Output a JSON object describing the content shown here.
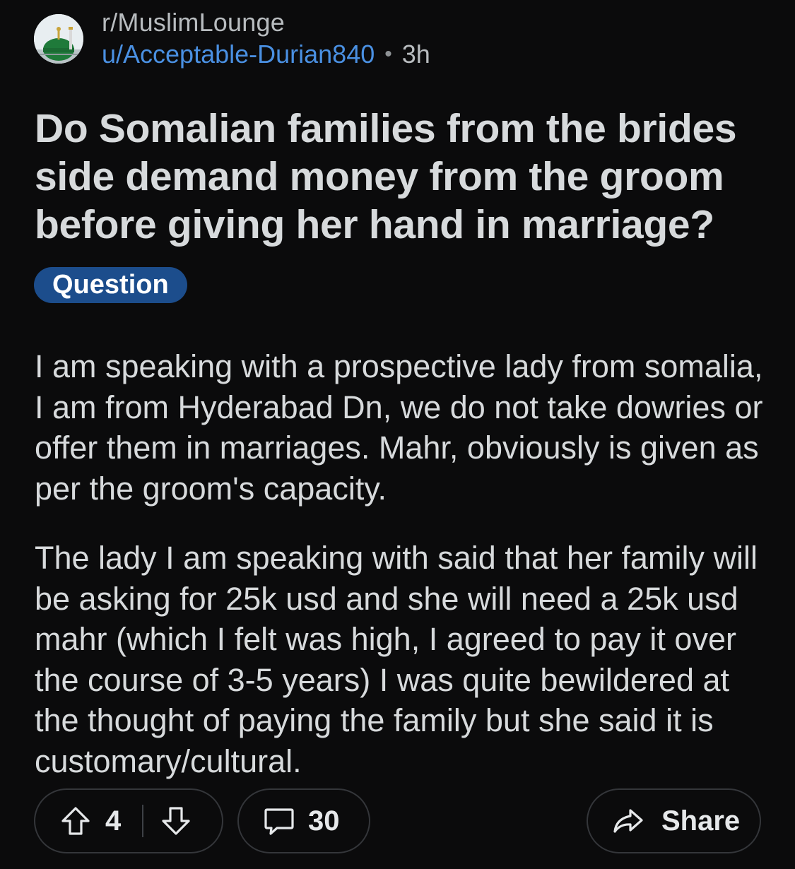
{
  "post": {
    "subreddit": "r/MuslimLounge",
    "author": "u/Acceptable-Durian840",
    "separator": "•",
    "age": "3h",
    "title": "Do Somalian families from the brides side demand money from the groom before giving her hand in marriage?",
    "flair": "Question",
    "flair_color": "#1c4d8c",
    "body": [
      "I am speaking with a prospective lady from somalia, I am from Hyderabad Dn, we do not take dowries or offer them in marriages. Mahr, obviously is given as per the groom's capacity.",
      "The lady I am speaking with said that her family will be asking for 25k usd and she will need a 25k usd mahr (which I felt was high, I agreed to pay it over the course of 3-5 years) I was quite bewildered at the thought of paying the family but she said it is customary/cultural."
    ]
  },
  "actions": {
    "upvote_icon": "arrow-up-icon",
    "score": "4",
    "downvote_icon": "arrow-down-icon",
    "comment_icon": "speech-bubble-icon",
    "comment_count": "30",
    "share_icon": "share-arrow-icon",
    "share_label": "Share"
  },
  "colors": {
    "background": "#0b0b0c",
    "text": "#d7dadc",
    "author_link": "#4a90e2",
    "pill_border": "#34363a"
  }
}
